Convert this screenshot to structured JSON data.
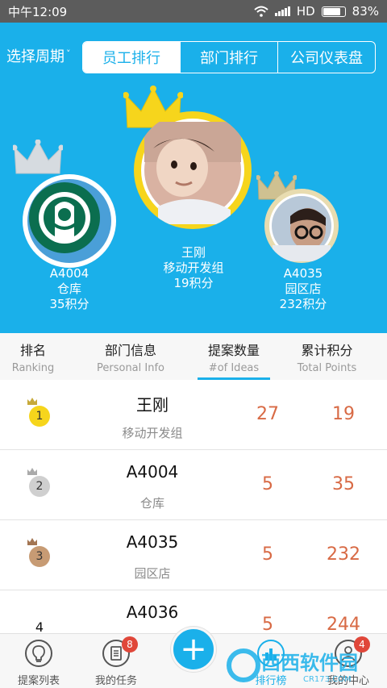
{
  "status": {
    "time": "中午12:09",
    "network": "HD",
    "battery": "83%",
    "battery_level": 0.83
  },
  "header": {
    "period_label": "选择周期",
    "tabs": [
      {
        "label": "员工排行",
        "active": true
      },
      {
        "label": "部门排行",
        "active": false
      },
      {
        "label": "公司仪表盘",
        "active": false
      }
    ]
  },
  "podium": [
    {
      "rank": 2,
      "name": "A4004",
      "dept": "仓库",
      "points": "35积分"
    },
    {
      "rank": 1,
      "name": "王刚",
      "dept": "移动开发组",
      "points": "19积分"
    },
    {
      "rank": 3,
      "name": "A4035",
      "dept": "园区店",
      "points": "232积分"
    }
  ],
  "table": {
    "columns": [
      {
        "cn": "排名",
        "en": "Ranking"
      },
      {
        "cn": "部门信息",
        "en": "Personal Info"
      },
      {
        "cn": "提案数量",
        "en": "#of Ideas",
        "active": true
      },
      {
        "cn": "累计积分",
        "en": "Total Points"
      }
    ],
    "rows": [
      {
        "rank": "1",
        "name": "王刚",
        "dept": "移动开发组",
        "ideas": "27",
        "points": "19"
      },
      {
        "rank": "2",
        "name": "A4004",
        "dept": "仓库",
        "ideas": "5",
        "points": "35"
      },
      {
        "rank": "3",
        "name": "A4035",
        "dept": "园区店",
        "ideas": "5",
        "points": "232"
      },
      {
        "rank": "4",
        "name": "A4036",
        "dept": "",
        "ideas": "5",
        "points": "244"
      }
    ]
  },
  "nav": {
    "items": [
      {
        "label": "提案列表",
        "icon": "lightbulb-icon"
      },
      {
        "label": "我的任务",
        "icon": "task-list-icon",
        "badge": "8"
      },
      {
        "label": "排行榜",
        "icon": "ranking-icon"
      },
      {
        "label": "我的中心",
        "icon": "profile-icon",
        "badge": "4"
      }
    ],
    "fab": "+"
  },
  "watermark": {
    "text": "西西软件园",
    "sub": "CR173.COM"
  },
  "colors": {
    "primary": "#1ab0ea",
    "accent_number": "#d86a45",
    "gold": "#f6d51c",
    "silver": "#cfcfcf",
    "bronze": "#c79b74"
  }
}
